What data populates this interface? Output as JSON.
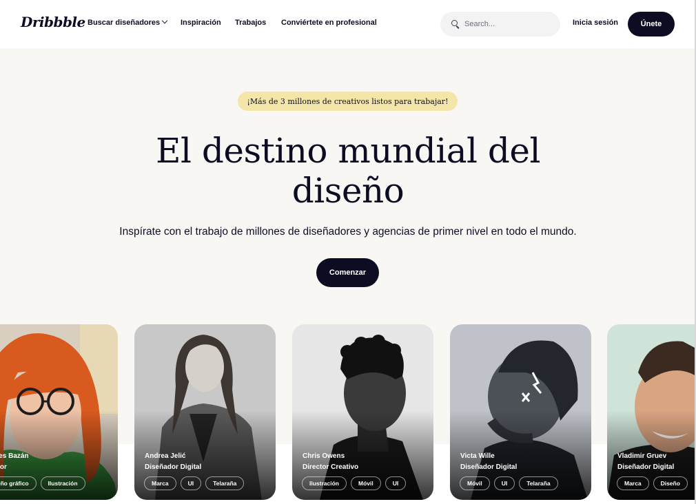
{
  "nav": {
    "logo": "Dribbble",
    "links": [
      "Buscar diseñadores",
      "Inspiración",
      "Trabajos",
      "Conviértete en profesional"
    ],
    "search_placeholder": "Search...",
    "signin": "Inicia sesión",
    "join": "Únete"
  },
  "hero": {
    "badge": "¡Más de 3 millones de creativos listos para trabajar!",
    "title_line1": "El destino mundial del",
    "title_line2": "diseño",
    "subtitle": "Inspírate con el trabajo de millones de diseñadores y agencias de primer nivel en todo el mundo.",
    "cta": "Comenzar"
  },
  "cards": [
    {
      "name": "cedes Bazán",
      "role": "trador",
      "tags": [
        "seño gráfico",
        "Ilustración"
      ]
    },
    {
      "name": "Andrea Jelić",
      "role": "Diseñador Digital",
      "tags": [
        "Marca",
        "UI",
        "Telaraña"
      ]
    },
    {
      "name": "Chris Owens",
      "role": "Director Creativo",
      "tags": [
        "Ilustración",
        "Móvil",
        "UI"
      ]
    },
    {
      "name": "Victa Wille",
      "role": "Diseñador Digital",
      "tags": [
        "Móvil",
        "UI",
        "Telaraña"
      ]
    },
    {
      "name": "Vladimir Gruev",
      "role": "Diseñador Digital",
      "tags": [
        "Marca",
        "Diseño"
      ]
    }
  ],
  "colors": {
    "accent": "#0d0c22",
    "badge": "#f3e6a8",
    "background": "#f8f7f4"
  }
}
